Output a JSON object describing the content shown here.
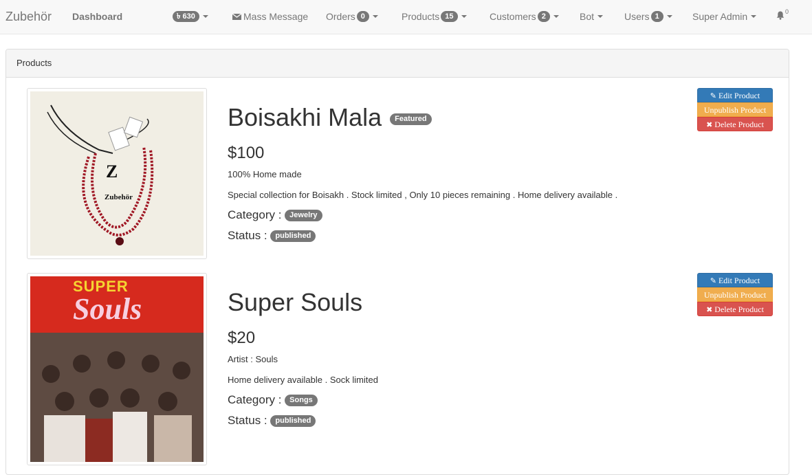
{
  "navbar": {
    "brand": "Zubehör",
    "dashboard": "Dashboard",
    "balance_badge": "৳ 630",
    "mass_message": "Mass Message",
    "orders": {
      "label": "Orders",
      "count": "0"
    },
    "products": {
      "label": "Products",
      "count": "15"
    },
    "customers": {
      "label": "Customers",
      "count": "2"
    },
    "bot": "Bot",
    "users": {
      "label": "Users",
      "count": "1"
    },
    "super_admin": "Super Admin",
    "notifications_count": "0"
  },
  "panel": {
    "heading": "Products"
  },
  "buttons": {
    "edit": "Edit Product",
    "unpublish": "Unpublish Product",
    "delete": "Delete Product"
  },
  "products": [
    {
      "name": "Boisakhi Mala",
      "featured": "Featured",
      "price": "$100",
      "line1": "100% Home made",
      "line2": "Special collection for Boisakh . Stock limited , Only 10 pieces remaining . Home delivery available .",
      "category_label": "Category :",
      "category": "Jewelry",
      "status_label": "Status :",
      "status": "published",
      "image_brand": "Zubehör"
    },
    {
      "name": "Super Souls",
      "price": "$20",
      "line1": "Artist : Souls",
      "line2": "Home delivery available . Sock limited",
      "category_label": "Category :",
      "category": "Songs",
      "status_label": "Status :",
      "status": "published",
      "image_title_top": "SUPER",
      "image_title_bottom": "Souls"
    }
  ],
  "colors": {
    "primary": "#337ab7",
    "warning": "#f0ad4e",
    "danger": "#d9534f",
    "badge": "#777777"
  }
}
